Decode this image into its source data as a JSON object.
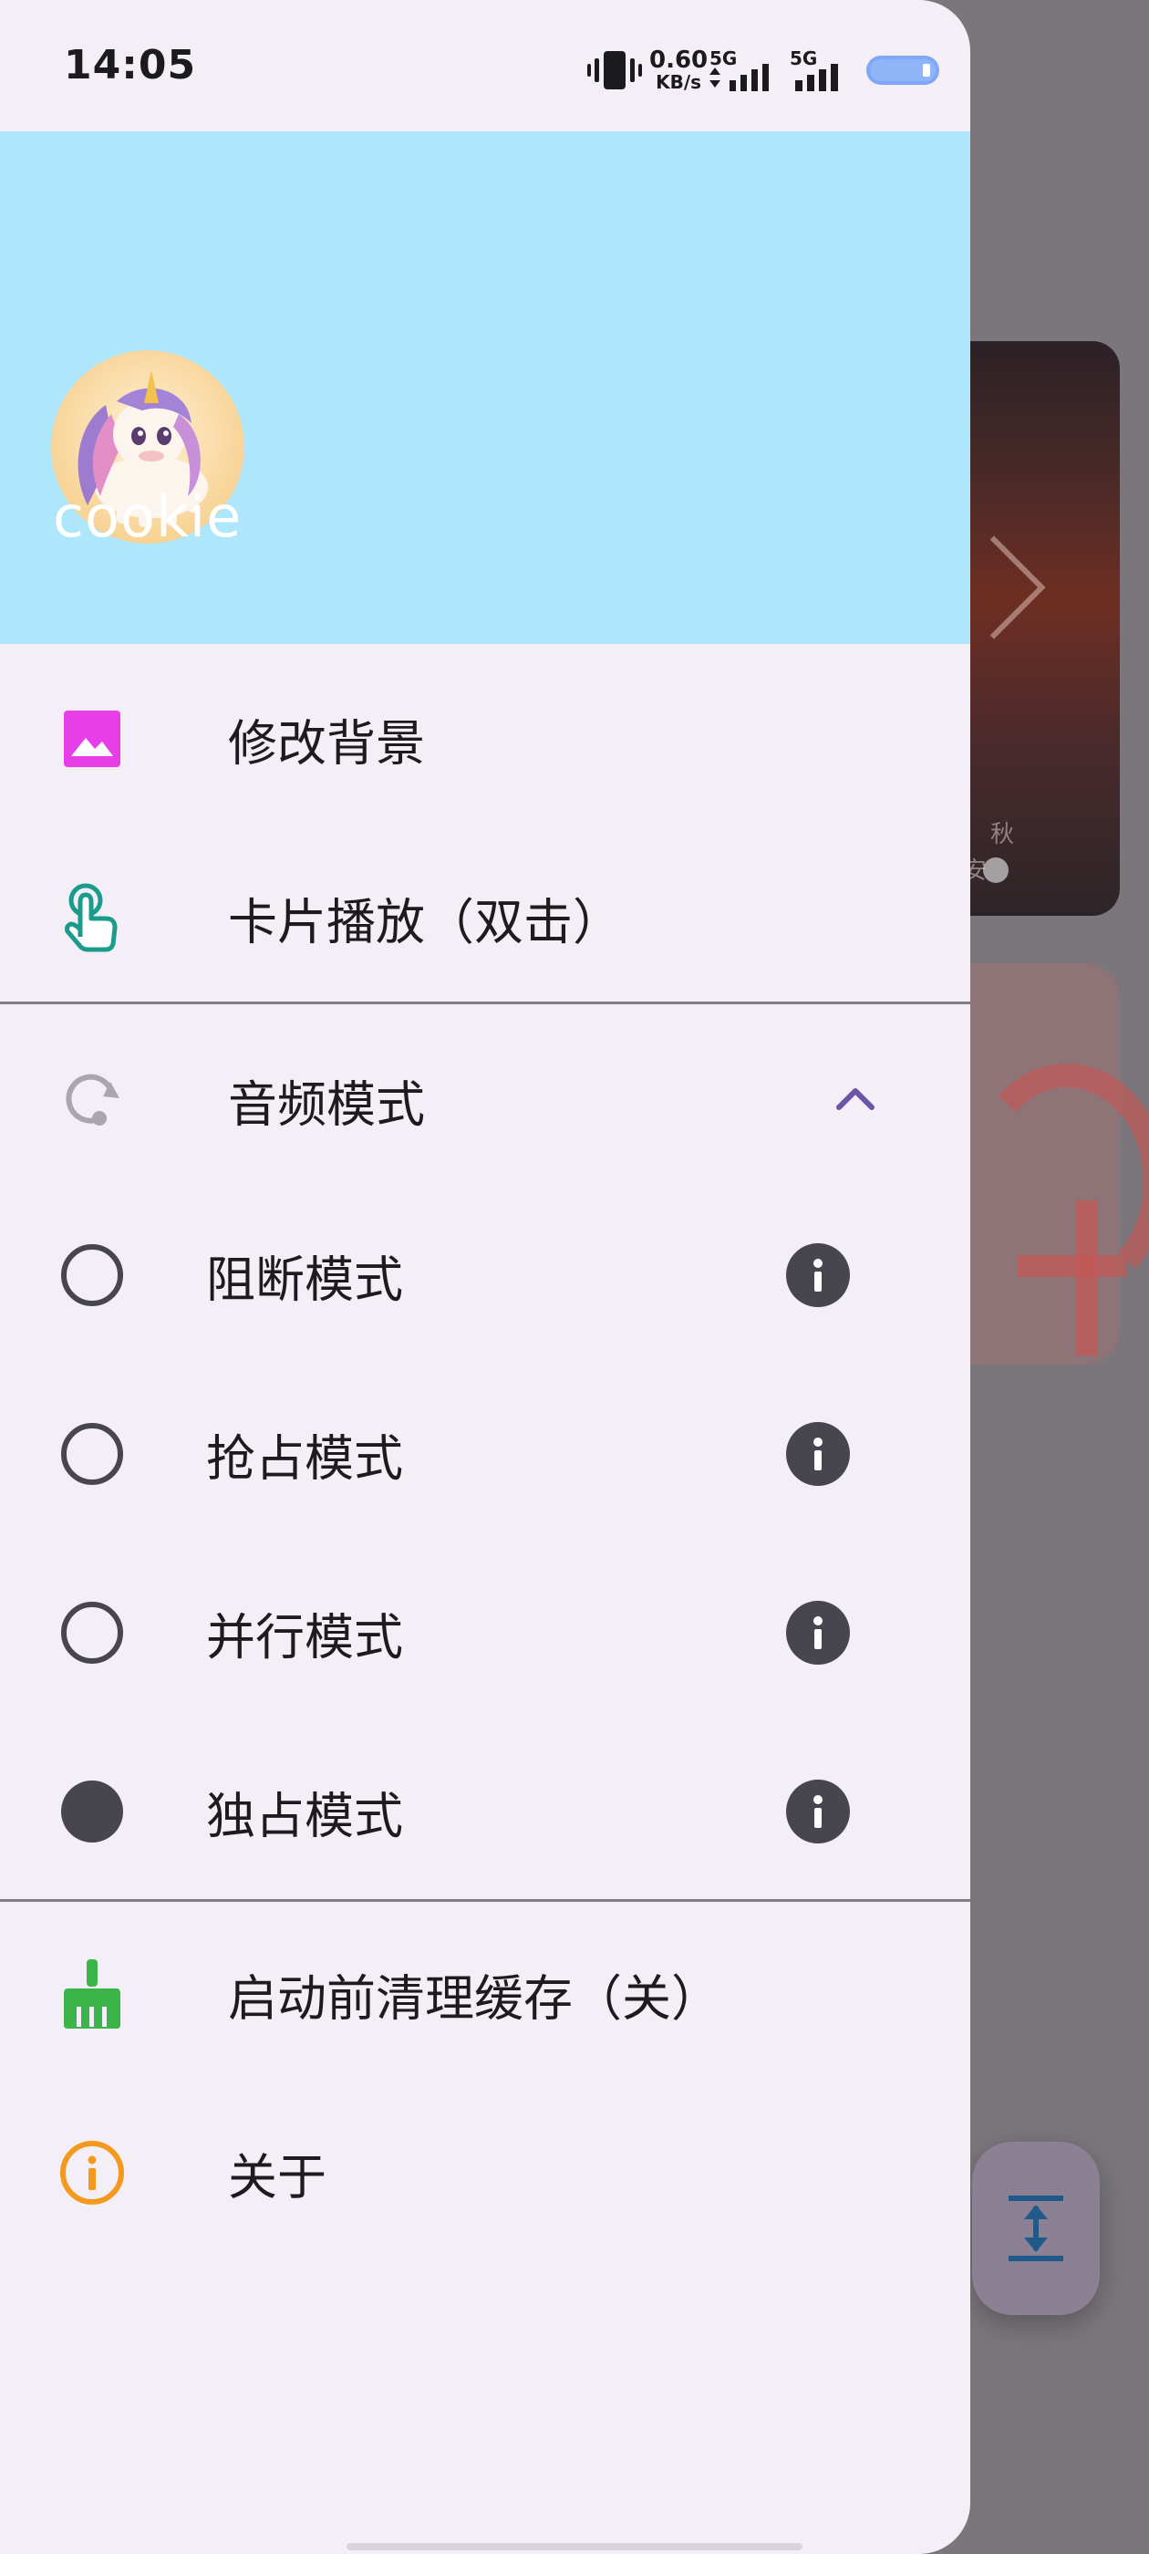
{
  "status_bar": {
    "time": "14:05",
    "net_speed_value": "0.60",
    "net_speed_unit": "KB/s",
    "sim1_label": "5G",
    "sim2_label": "5G"
  },
  "drawer": {
    "header": {
      "username": "cookie",
      "background_color": "#aee6fb"
    },
    "items": [
      {
        "label": "修改背景",
        "icon": "image-icon",
        "icon_color": "#e83ee8"
      },
      {
        "label": "卡片播放（双击）",
        "icon": "touch-icon",
        "icon_color": "#1a9b8c"
      }
    ],
    "audio_mode": {
      "label": "音频模式",
      "icon": "audio-mode-icon",
      "expanded": true,
      "options": [
        {
          "label": "阻断模式",
          "selected": false
        },
        {
          "label": "抢占模式",
          "selected": false
        },
        {
          "label": "并行模式",
          "selected": false
        },
        {
          "label": "独占模式",
          "selected": true
        }
      ]
    },
    "footer_items": [
      {
        "label": "启动前清理缓存（关）",
        "icon": "broom-icon",
        "icon_color": "#3bb54a"
      },
      {
        "label": "关于",
        "icon": "info-outline-icon",
        "icon_color": "#f39a1e"
      }
    ]
  },
  "background": {
    "card_text_1": "秋",
    "card_text_2": "安"
  }
}
